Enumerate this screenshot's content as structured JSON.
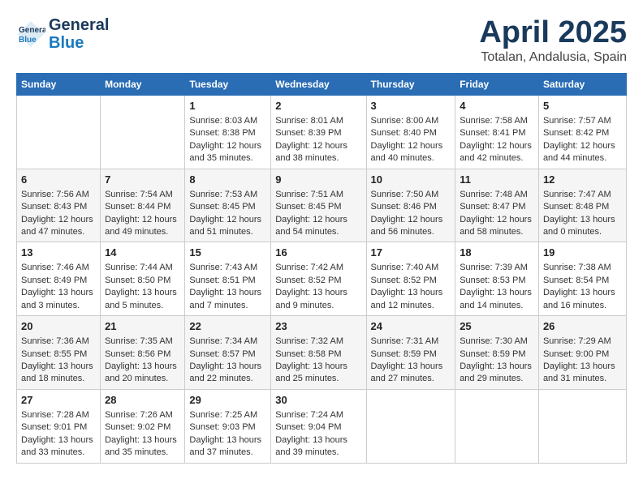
{
  "header": {
    "logo_line1": "General",
    "logo_line2": "Blue",
    "month_title": "April 2025",
    "location": "Totalan, Andalusia, Spain"
  },
  "weekdays": [
    "Sunday",
    "Monday",
    "Tuesday",
    "Wednesday",
    "Thursday",
    "Friday",
    "Saturday"
  ],
  "weeks": [
    [
      {
        "day": "",
        "sunrise": "",
        "sunset": "",
        "daylight": ""
      },
      {
        "day": "",
        "sunrise": "",
        "sunset": "",
        "daylight": ""
      },
      {
        "day": "1",
        "sunrise": "Sunrise: 8:03 AM",
        "sunset": "Sunset: 8:38 PM",
        "daylight": "Daylight: 12 hours and 35 minutes."
      },
      {
        "day": "2",
        "sunrise": "Sunrise: 8:01 AM",
        "sunset": "Sunset: 8:39 PM",
        "daylight": "Daylight: 12 hours and 38 minutes."
      },
      {
        "day": "3",
        "sunrise": "Sunrise: 8:00 AM",
        "sunset": "Sunset: 8:40 PM",
        "daylight": "Daylight: 12 hours and 40 minutes."
      },
      {
        "day": "4",
        "sunrise": "Sunrise: 7:58 AM",
        "sunset": "Sunset: 8:41 PM",
        "daylight": "Daylight: 12 hours and 42 minutes."
      },
      {
        "day": "5",
        "sunrise": "Sunrise: 7:57 AM",
        "sunset": "Sunset: 8:42 PM",
        "daylight": "Daylight: 12 hours and 44 minutes."
      }
    ],
    [
      {
        "day": "6",
        "sunrise": "Sunrise: 7:56 AM",
        "sunset": "Sunset: 8:43 PM",
        "daylight": "Daylight: 12 hours and 47 minutes."
      },
      {
        "day": "7",
        "sunrise": "Sunrise: 7:54 AM",
        "sunset": "Sunset: 8:44 PM",
        "daylight": "Daylight: 12 hours and 49 minutes."
      },
      {
        "day": "8",
        "sunrise": "Sunrise: 7:53 AM",
        "sunset": "Sunset: 8:45 PM",
        "daylight": "Daylight: 12 hours and 51 minutes."
      },
      {
        "day": "9",
        "sunrise": "Sunrise: 7:51 AM",
        "sunset": "Sunset: 8:45 PM",
        "daylight": "Daylight: 12 hours and 54 minutes."
      },
      {
        "day": "10",
        "sunrise": "Sunrise: 7:50 AM",
        "sunset": "Sunset: 8:46 PM",
        "daylight": "Daylight: 12 hours and 56 minutes."
      },
      {
        "day": "11",
        "sunrise": "Sunrise: 7:48 AM",
        "sunset": "Sunset: 8:47 PM",
        "daylight": "Daylight: 12 hours and 58 minutes."
      },
      {
        "day": "12",
        "sunrise": "Sunrise: 7:47 AM",
        "sunset": "Sunset: 8:48 PM",
        "daylight": "Daylight: 13 hours and 0 minutes."
      }
    ],
    [
      {
        "day": "13",
        "sunrise": "Sunrise: 7:46 AM",
        "sunset": "Sunset: 8:49 PM",
        "daylight": "Daylight: 13 hours and 3 minutes."
      },
      {
        "day": "14",
        "sunrise": "Sunrise: 7:44 AM",
        "sunset": "Sunset: 8:50 PM",
        "daylight": "Daylight: 13 hours and 5 minutes."
      },
      {
        "day": "15",
        "sunrise": "Sunrise: 7:43 AM",
        "sunset": "Sunset: 8:51 PM",
        "daylight": "Daylight: 13 hours and 7 minutes."
      },
      {
        "day": "16",
        "sunrise": "Sunrise: 7:42 AM",
        "sunset": "Sunset: 8:52 PM",
        "daylight": "Daylight: 13 hours and 9 minutes."
      },
      {
        "day": "17",
        "sunrise": "Sunrise: 7:40 AM",
        "sunset": "Sunset: 8:52 PM",
        "daylight": "Daylight: 13 hours and 12 minutes."
      },
      {
        "day": "18",
        "sunrise": "Sunrise: 7:39 AM",
        "sunset": "Sunset: 8:53 PM",
        "daylight": "Daylight: 13 hours and 14 minutes."
      },
      {
        "day": "19",
        "sunrise": "Sunrise: 7:38 AM",
        "sunset": "Sunset: 8:54 PM",
        "daylight": "Daylight: 13 hours and 16 minutes."
      }
    ],
    [
      {
        "day": "20",
        "sunrise": "Sunrise: 7:36 AM",
        "sunset": "Sunset: 8:55 PM",
        "daylight": "Daylight: 13 hours and 18 minutes."
      },
      {
        "day": "21",
        "sunrise": "Sunrise: 7:35 AM",
        "sunset": "Sunset: 8:56 PM",
        "daylight": "Daylight: 13 hours and 20 minutes."
      },
      {
        "day": "22",
        "sunrise": "Sunrise: 7:34 AM",
        "sunset": "Sunset: 8:57 PM",
        "daylight": "Daylight: 13 hours and 22 minutes."
      },
      {
        "day": "23",
        "sunrise": "Sunrise: 7:32 AM",
        "sunset": "Sunset: 8:58 PM",
        "daylight": "Daylight: 13 hours and 25 minutes."
      },
      {
        "day": "24",
        "sunrise": "Sunrise: 7:31 AM",
        "sunset": "Sunset: 8:59 PM",
        "daylight": "Daylight: 13 hours and 27 minutes."
      },
      {
        "day": "25",
        "sunrise": "Sunrise: 7:30 AM",
        "sunset": "Sunset: 8:59 PM",
        "daylight": "Daylight: 13 hours and 29 minutes."
      },
      {
        "day": "26",
        "sunrise": "Sunrise: 7:29 AM",
        "sunset": "Sunset: 9:00 PM",
        "daylight": "Daylight: 13 hours and 31 minutes."
      }
    ],
    [
      {
        "day": "27",
        "sunrise": "Sunrise: 7:28 AM",
        "sunset": "Sunset: 9:01 PM",
        "daylight": "Daylight: 13 hours and 33 minutes."
      },
      {
        "day": "28",
        "sunrise": "Sunrise: 7:26 AM",
        "sunset": "Sunset: 9:02 PM",
        "daylight": "Daylight: 13 hours and 35 minutes."
      },
      {
        "day": "29",
        "sunrise": "Sunrise: 7:25 AM",
        "sunset": "Sunset: 9:03 PM",
        "daylight": "Daylight: 13 hours and 37 minutes."
      },
      {
        "day": "30",
        "sunrise": "Sunrise: 7:24 AM",
        "sunset": "Sunset: 9:04 PM",
        "daylight": "Daylight: 13 hours and 39 minutes."
      },
      {
        "day": "",
        "sunrise": "",
        "sunset": "",
        "daylight": ""
      },
      {
        "day": "",
        "sunrise": "",
        "sunset": "",
        "daylight": ""
      },
      {
        "day": "",
        "sunrise": "",
        "sunset": "",
        "daylight": ""
      }
    ]
  ]
}
